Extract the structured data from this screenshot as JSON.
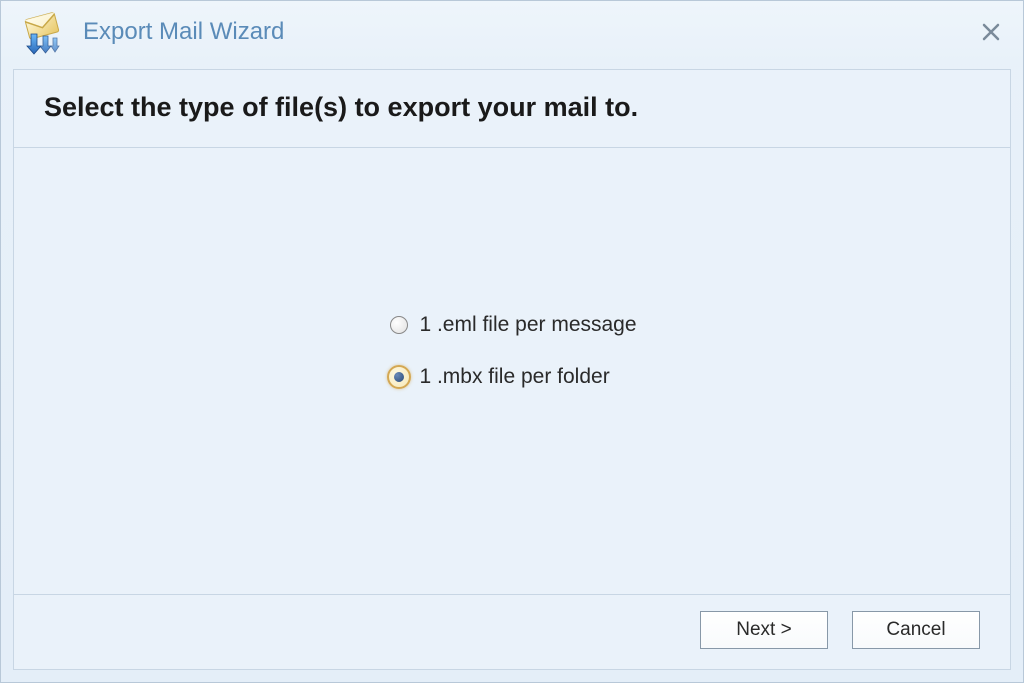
{
  "window": {
    "title": "Export Mail Wizard"
  },
  "heading": "Select the type of file(s) to export your mail to.",
  "options": {
    "eml": {
      "label": "1 .eml file per message",
      "selected": false
    },
    "mbx": {
      "label": "1 .mbx file per folder",
      "selected": true
    }
  },
  "buttons": {
    "next": "Next >",
    "cancel": "Cancel"
  }
}
